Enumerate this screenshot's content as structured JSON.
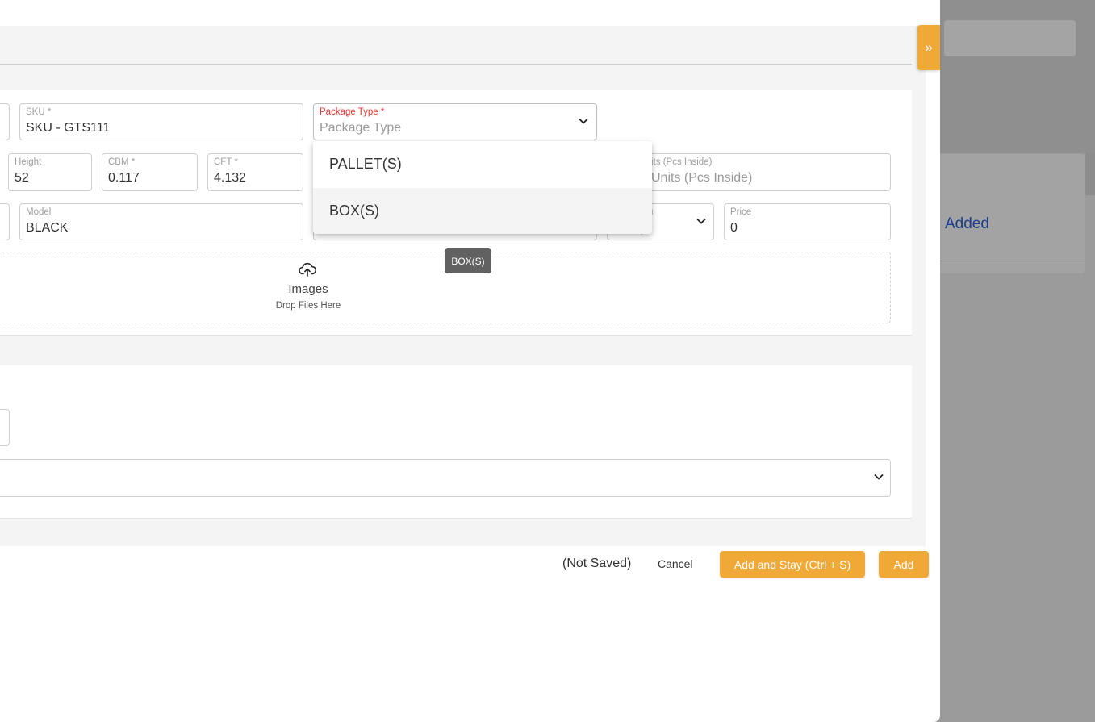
{
  "background": {
    "added_text": "Added"
  },
  "drawer": {
    "toggle_icon": "»",
    "fields": {
      "sku": {
        "label": "SKU *",
        "value": "SKU - GTS111"
      },
      "package_type": {
        "label": "Package Type *",
        "placeholder": "Package Type"
      },
      "height": {
        "label": "Height",
        "value": "52"
      },
      "cbm": {
        "label": "CBM *",
        "value": "0.117"
      },
      "cft": {
        "label": "CFT *",
        "value": "4.132"
      },
      "units": {
        "label": "its (Pcs Inside)",
        "placeholder": "Units (Pcs Inside)"
      },
      "model": {
        "label": "Model",
        "value": "BLACK"
      },
      "currency": {
        "label": "u",
        "placeholder": "ncy"
      },
      "price": {
        "label": "Price",
        "value": "0"
      }
    },
    "dropzone": {
      "title": "Images",
      "subtitle": "Drop Files Here"
    },
    "package_dropdown": {
      "options": [
        "PALLET(S)",
        "BOX(S)"
      ],
      "hovered": "BOX(S)"
    },
    "tooltip": "BOX(S)",
    "footer": {
      "status": "(Not Saved)",
      "cancel_label": "Cancel",
      "add_stay_label": "Add and Stay (Ctrl + S)",
      "add_label": "Add"
    }
  },
  "colors": {
    "accent": "#f0a837",
    "required_label": "#e53935",
    "link_blue": "#1a3e8c"
  }
}
